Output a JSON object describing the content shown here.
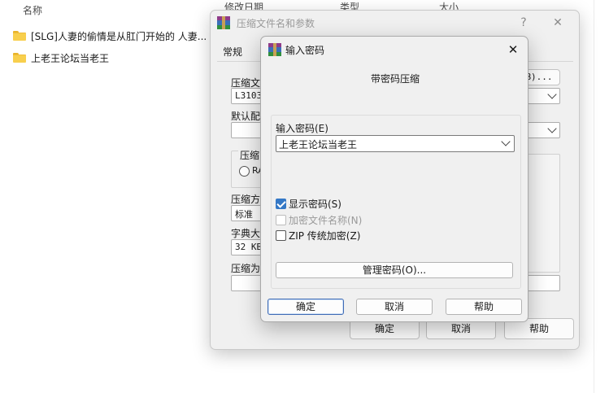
{
  "explorer": {
    "columns": {
      "name": "名称",
      "modified": "修改日期",
      "type": "类型",
      "size": "大小"
    },
    "files": [
      {
        "name": "[SLG]人妻的偷情是从肛门开始的  人妻..."
      },
      {
        "name": "上老王论坛当老王"
      }
    ]
  },
  "main_dialog": {
    "title": "压缩文件名和参数",
    "help_symbol": "?",
    "close_symbol": "✕",
    "tab_general": "常规",
    "archive_name_label": "压缩文",
    "archive_name_value": "L3103.",
    "browse_button": "B)...",
    "default_profile_label": "默认配",
    "format_group_label": "压缩",
    "rar_option": "RA",
    "method_label": "压缩方",
    "method_value": "标准",
    "dict_label": "字典大",
    "dict_value": "32 KB",
    "split_label": "压缩为",
    "ok_button": "确定",
    "cancel_button": "取消",
    "help_button": "帮助"
  },
  "password_dialog": {
    "title": "输入密码",
    "close_symbol": "✕",
    "heading": "带密码压缩",
    "password_label": "输入密码(E)",
    "password_value": "上老王论坛当老王",
    "show_password": {
      "label": "显示密码(S)",
      "checked": true
    },
    "encrypt_names": {
      "label": "加密文件名称(N)",
      "checked": false,
      "disabled": true
    },
    "zip_legacy": {
      "label": "ZIP 传统加密(Z)",
      "checked": false
    },
    "manage_button": "管理密码(O)...",
    "ok_button": "确定",
    "cancel_button": "取消",
    "help_button": "帮助"
  },
  "colors": {
    "accent": "#3478c6",
    "folder": "#f8cf4d"
  }
}
